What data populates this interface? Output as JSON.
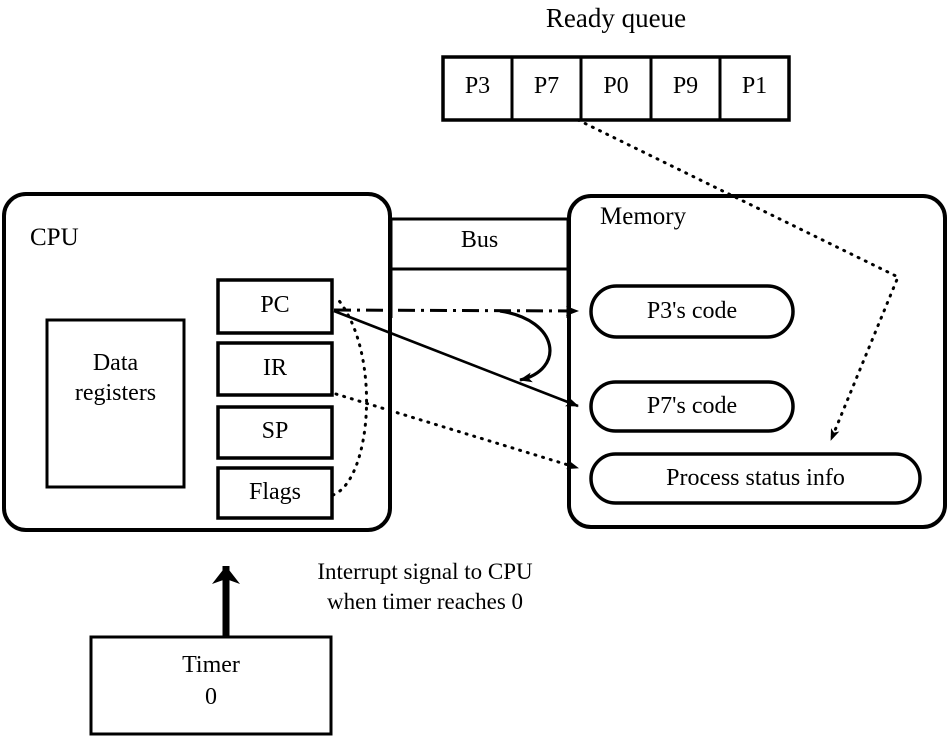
{
  "diagram": {
    "title_ready_queue": "Ready queue",
    "ready_queue": {
      "label": "Ready queue",
      "cells": [
        "P3",
        "P7",
        "P0",
        "P9",
        "P1"
      ]
    },
    "cpu": {
      "label": "CPU",
      "data_registers": {
        "line1": "Data",
        "line2": "registers"
      },
      "registers": [
        {
          "name": "PC"
        },
        {
          "name": "IR"
        },
        {
          "name": "SP"
        },
        {
          "name": "Flags"
        }
      ]
    },
    "bus": {
      "label": "Bus"
    },
    "memory": {
      "label": "Memory",
      "blocks": [
        {
          "label": "P3's code"
        },
        {
          "label": "P7's code"
        },
        {
          "label": "Process status info"
        }
      ]
    },
    "timer": {
      "label": "Timer",
      "value": "0"
    },
    "interrupt_note": {
      "line1": "Interrupt signal to CPU",
      "line2": "when timer reaches 0"
    },
    "colors": {
      "stroke": "#000000",
      "background": "#ffffff"
    }
  }
}
